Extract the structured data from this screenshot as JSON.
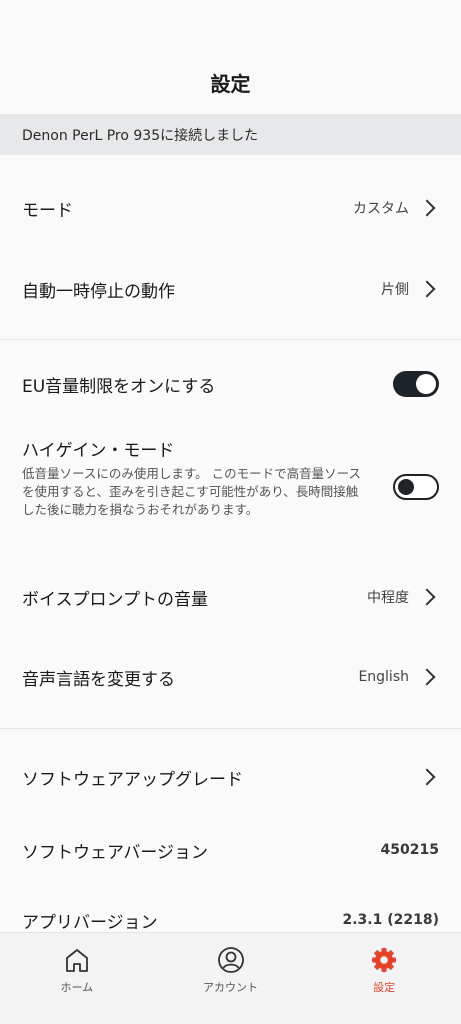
{
  "header": {
    "title": "設定"
  },
  "banner": {
    "text": "Denon PerL Pro 935に接続しました"
  },
  "settings": {
    "mode": {
      "label": "モード",
      "value": "カスタム"
    },
    "auto_pause": {
      "label": "自動一時停止の動作",
      "value": "片側"
    },
    "eu_volume": {
      "label": "EU音量制限をオンにする",
      "enabled": true
    },
    "high_gain": {
      "label": "ハイゲイン・モード",
      "description": "低音量ソースにのみ使用します。 このモードで高音量ソースを使用すると、歪みを引き起こす可能性があり、長時間接触した後に聴力を損なうおそれがあります。",
      "enabled": false
    },
    "voice_prompt": {
      "label": "ボイスプロンプトの音量",
      "value": "中程度"
    },
    "voice_language": {
      "label": "音声言語を変更する",
      "value": "English"
    },
    "software_upgrade": {
      "label": "ソフトウェアアップグレード"
    },
    "software_version": {
      "label": "ソフトウェアバージョン",
      "value": "450215"
    },
    "app_version": {
      "label": "アプリバージョン",
      "value": "2.3.1 (2218)"
    }
  },
  "tabs": {
    "home": "ホーム",
    "account": "アカウント",
    "settings": "設定"
  },
  "colors": {
    "accent": "#e0452b",
    "toggle_dark": "#1e2328",
    "banner_bg": "#e6e8ea"
  }
}
